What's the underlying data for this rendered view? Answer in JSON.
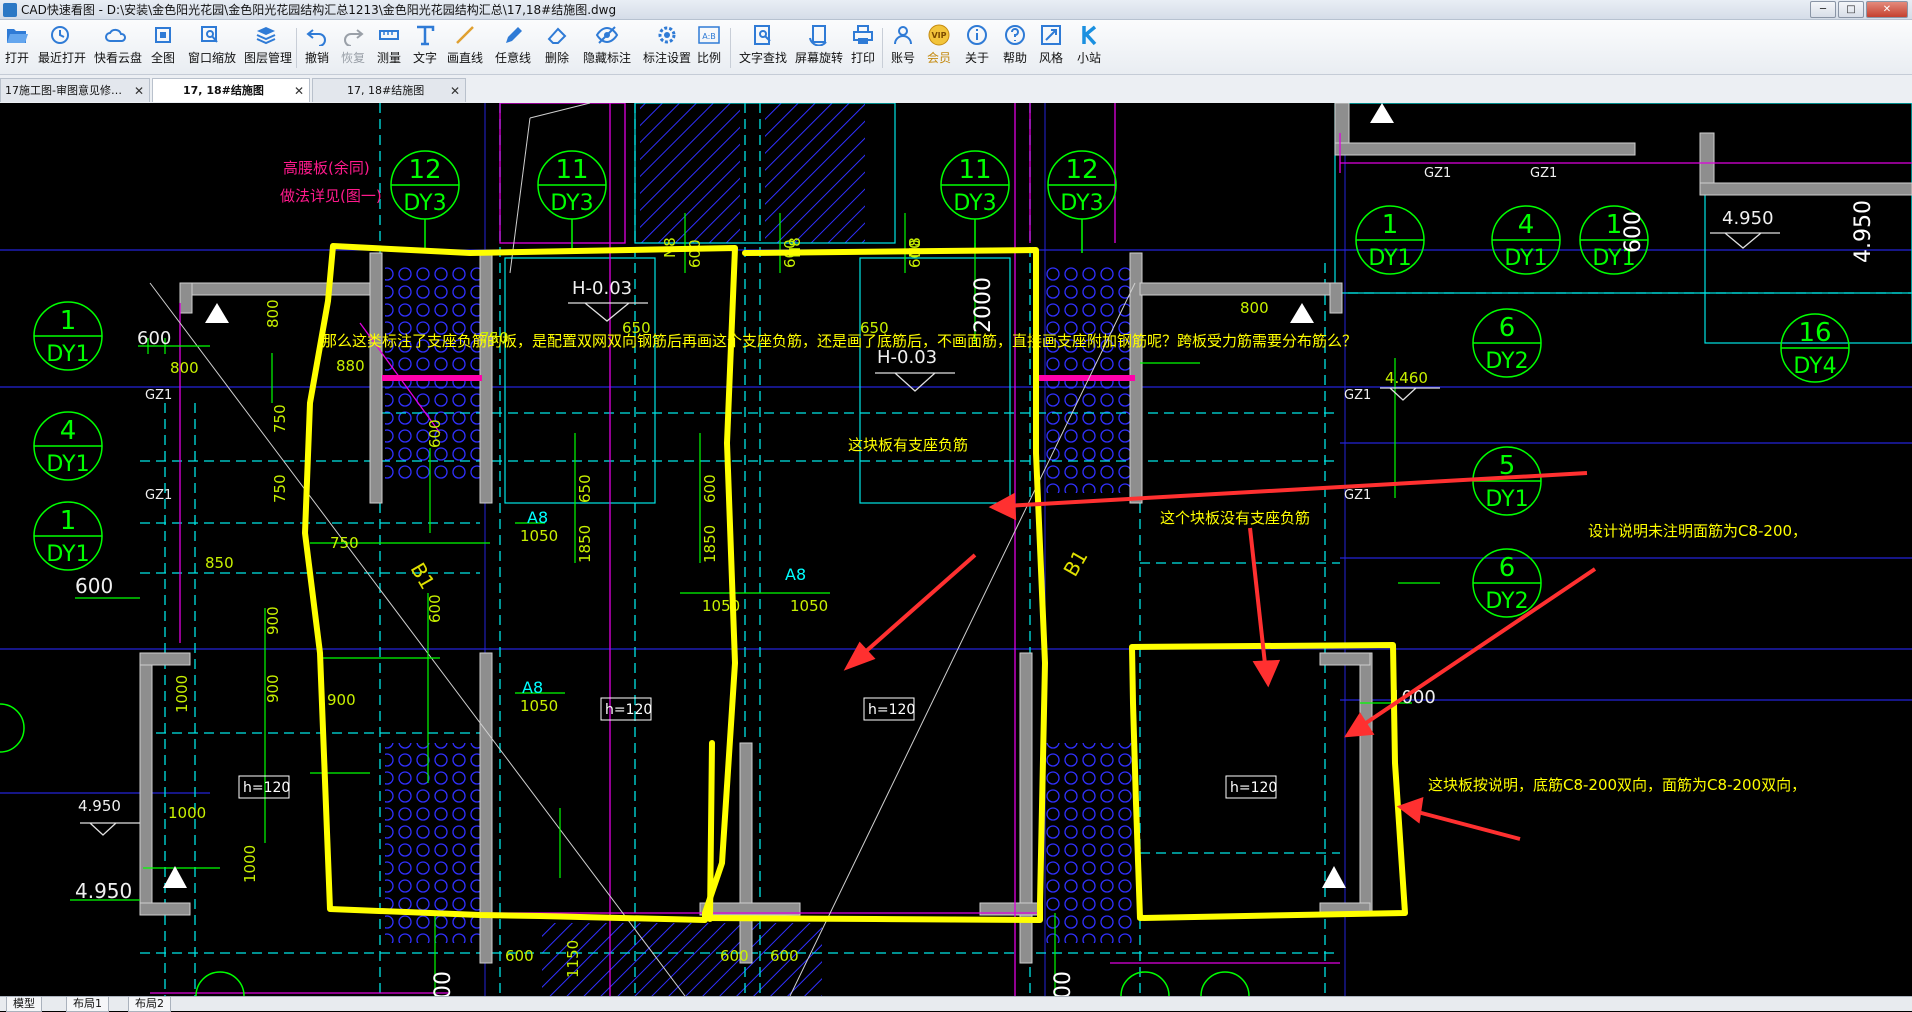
{
  "window": {
    "title": "CAD快速看图 - D:\\安装\\金色阳光花园\\金色阳光花园结构汇总1213\\金色阳光花园结构汇总\\17,18#结施图.dwg",
    "controls": [
      "─",
      "□",
      "✕"
    ]
  },
  "toolbar": {
    "open": "打开",
    "recent": "最近打开",
    "cloud": "快看云盘",
    "fit": "全图",
    "window_zoom": "窗口缩放",
    "layers": "图层管理",
    "undo": "撤销",
    "redo": "恢复",
    "measure": "测量",
    "text": "文字",
    "line": "画直线",
    "freeline": "任意线",
    "erase": "删除",
    "hide_annot": "隐藏标注",
    "annot_settings": "标注设置",
    "scale": "比例",
    "text_search": "文字查找",
    "rotate": "屏幕旋转",
    "print": "打印",
    "account": "账号",
    "vip": "会员",
    "about": "关于",
    "help": "帮助",
    "style": "风格",
    "site": "小站",
    "vip_badge": "VIP",
    "scale_icon": "A:B"
  },
  "tabs": [
    {
      "label": "17施工图-审图意见修…",
      "close": "✕"
    },
    {
      "label": "17, 18#结施图",
      "close": "✕"
    },
    {
      "label": "17, 18#结施图",
      "close": "✕"
    }
  ],
  "layout_tabs": [
    "模型",
    "布局1",
    "布局2"
  ],
  "drawing": {
    "axes": {
      "top": [
        {
          "num": "12",
          "code": "DY3"
        },
        {
          "num": "11",
          "code": "DY3"
        },
        {
          "num": "11",
          "code": "DY3"
        },
        {
          "num": "12",
          "code": "DY3"
        },
        {
          "num": "1",
          "code": "DY1"
        },
        {
          "num": "4",
          "code": "DY1"
        },
        {
          "num": "1",
          "code": "DY1"
        }
      ],
      "left": [
        {
          "num": "1",
          "code": "DY1"
        },
        {
          "num": "4",
          "code": "DY1"
        },
        {
          "num": "1",
          "code": "DY1"
        }
      ],
      "right": [
        {
          "num": "6",
          "code": "DY2"
        },
        {
          "num": "16",
          "code": "DY4"
        },
        {
          "num": "5",
          "code": "DY1"
        },
        {
          "num": "6",
          "code": "DY2"
        }
      ]
    },
    "labels": {
      "h_neg": "H-0.03",
      "h_neg2": "H-0.03",
      "a8": "A8",
      "b1": "B1",
      "h120": "h=120",
      "gz1": "GZ1",
      "elev_4950": "4.950",
      "elev_4460": "4.460",
      "n8": "N8",
      "magenta_note_1": "高腰板(余同)",
      "magenta_note_2": "做法详见(图一)"
    },
    "dims": [
      "600",
      "800",
      "880",
      "750",
      "750",
      "850",
      "900",
      "900",
      "1000",
      "1000",
      "1000",
      "1050",
      "1050",
      "1150",
      "650",
      "1850",
      "600",
      "1000",
      "2000",
      "1000",
      "4.950",
      "800",
      "1000"
    ]
  },
  "annotations": {
    "question": "那么这类标注了支座负筋的板，是配置双网双向钢筋后再画这个支座负筋，还是画了底筋后，不画面筋，直接画支座附加钢筋呢？跨板受力筋需要分布筋么？",
    "has_neg": "这块板有支座负筋",
    "no_neg": "这个块板没有支座负筋",
    "design_note": "设计说明未注明面筋为C8-200，",
    "by_note": "这块板按说明，底筋C8-200双向，面筋为C8-200双向，"
  },
  "colors": {
    "cyan": "#00ffff",
    "green": "#00ff00",
    "yellow": "#ffff00",
    "magenta": "#ff00ff",
    "blue": "#3030ff",
    "red": "#ff3030",
    "gray": "#9a9a9a"
  }
}
